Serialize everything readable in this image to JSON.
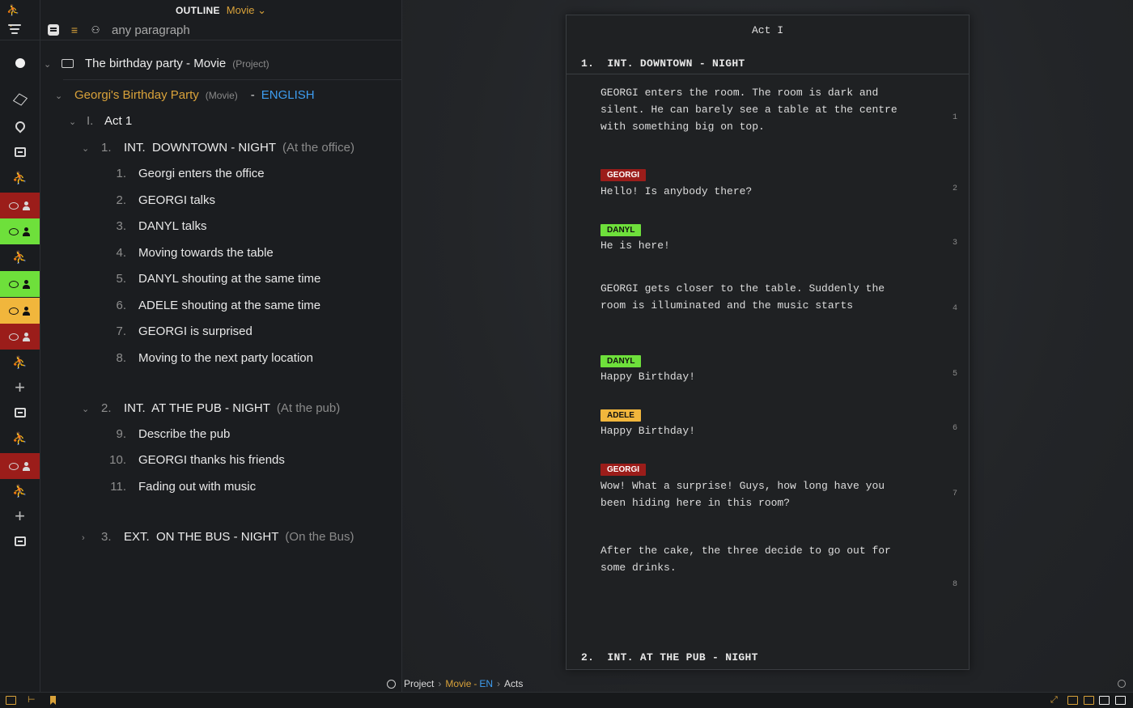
{
  "outline": {
    "title": "OUTLINE",
    "mode": "Movie",
    "search_placeholder": "any paragraph",
    "project": {
      "name": "The birthday party - Movie",
      "type": "(Project)"
    },
    "movie": {
      "name": "Georgi's Birthday Party",
      "type": "(Movie)",
      "dash": "-",
      "language": "ENGLISH"
    },
    "act": {
      "num": "I.",
      "name": "Act 1"
    },
    "scenes": [
      {
        "num": "1.",
        "heading": "INT.  DOWNTOWN - NIGHT",
        "location": "(At the office)",
        "items": [
          {
            "num": "1.",
            "text": "Georgi enters the office"
          },
          {
            "num": "2.",
            "text": "GEORGI talks"
          },
          {
            "num": "3.",
            "text": "DANYL talks"
          },
          {
            "num": "4.",
            "text": "Moving towards the table"
          },
          {
            "num": "5.",
            "text": "DANYL shouting at the same time"
          },
          {
            "num": "6.",
            "text": "ADELE shouting at the same time"
          },
          {
            "num": "7.",
            "text": "GEORGI is surprised"
          },
          {
            "num": "8.",
            "text": "Moving to the next party location"
          }
        ]
      },
      {
        "num": "2.",
        "heading": "INT.  AT THE PUB - NIGHT",
        "location": "(At the pub)",
        "items": [
          {
            "num": "9.",
            "text": "Describe the pub"
          },
          {
            "num": "10.",
            "text": "GEORGI thanks his friends"
          },
          {
            "num": "11.",
            "text": "Fading out with music"
          }
        ]
      },
      {
        "num": "3.",
        "heading": "EXT.  ON THE BUS - NIGHT",
        "location": "(On the Bus)",
        "items": []
      }
    ]
  },
  "rail": {
    "items": [
      {
        "icon": "circle-icon",
        "color": ""
      },
      {
        "icon": "cube-icon",
        "color": ""
      },
      {
        "icon": "location-pin-icon",
        "color": ""
      },
      {
        "icon": "film-icon",
        "color": ""
      },
      {
        "icon": "action-runner-icon",
        "color": ""
      },
      {
        "icon": "dialogue-icon",
        "color": "#9b1d1a"
      },
      {
        "icon": "dialogue-icon",
        "color": "#6ee03b"
      },
      {
        "icon": "action-runner-icon",
        "color": ""
      },
      {
        "icon": "dialogue-icon",
        "color": "#6ee03b"
      },
      {
        "icon": "dialogue-icon",
        "color": "#f1b63c"
      },
      {
        "icon": "dialogue-icon",
        "color": "#9b1d1a"
      },
      {
        "icon": "action-runner-icon",
        "color": ""
      },
      {
        "icon": "plus-icon",
        "color": ""
      },
      {
        "icon": "film-icon",
        "color": ""
      },
      {
        "icon": "action-runner-icon",
        "color": ""
      },
      {
        "icon": "dialogue-icon",
        "color": "#9b1d1a"
      },
      {
        "icon": "action-runner-icon",
        "color": ""
      },
      {
        "icon": "plus-icon",
        "color": ""
      },
      {
        "icon": "film-icon",
        "color": ""
      }
    ]
  },
  "script": {
    "act_title": "Act I",
    "scene1": {
      "num": "1.",
      "heading": "INT. DOWNTOWN - NIGHT"
    },
    "scene2": {
      "num": "2.",
      "heading": "INT. AT THE PUB - NIGHT"
    },
    "paragraphs": [
      {
        "character": "",
        "text": "GEORGI enters the room. The room is dark and silent. He can barely see a table at the centre with something big on top.",
        "number": "1"
      },
      {
        "character": "GEORGI",
        "text": "Hello! Is anybody there?",
        "number": "2"
      },
      {
        "character": "DANYL",
        "text": "He is here!",
        "number": "3"
      },
      {
        "character": "",
        "text": "GEORGI gets closer to the table. Suddenly the room is illuminated and the music starts",
        "number": "4"
      },
      {
        "character": "DANYL",
        "text": "Happy Birthday!",
        "number": "5"
      },
      {
        "character": "ADELE",
        "text": "Happy Birthday!",
        "number": "6"
      },
      {
        "character": "GEORGI",
        "text": "Wow! What a surprise! Guys, how long have you been hiding here in this room?",
        "number": "7"
      },
      {
        "character": "",
        "text": "After the cake, the three decide to go out for some drinks.",
        "number": "8"
      }
    ],
    "character_colors": {
      "GEORGI": "#9b1d1a",
      "DANYL": "#6ee03b",
      "ADELE": "#f1b63c"
    }
  },
  "breadcrumb": {
    "root": "Project",
    "movie": "Movie",
    "dash": "-",
    "lang": "EN",
    "leaf": "Acts"
  }
}
